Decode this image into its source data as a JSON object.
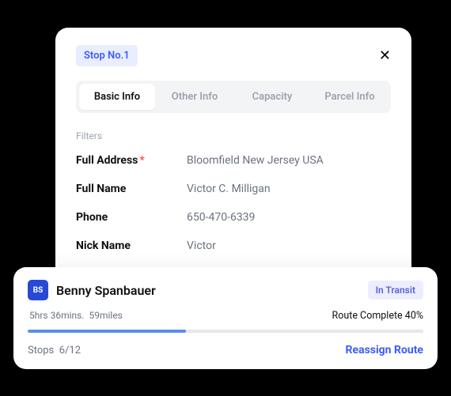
{
  "modal": {
    "stop_chip": "Stop No.1",
    "tabs": [
      {
        "label": "Basic Info",
        "active": true
      },
      {
        "label": "Other Info",
        "active": false
      },
      {
        "label": "Capacity",
        "active": false
      },
      {
        "label": "Parcel Info",
        "active": false
      }
    ],
    "filters_label": "Filters",
    "fields": {
      "full_address": {
        "label": "Full Address",
        "value": "Bloomfield New Jersey USA",
        "required": true
      },
      "full_name": {
        "label": "Full Name",
        "value": "Victor C. Milligan"
      },
      "phone": {
        "label": "Phone",
        "value": "650-470-6339"
      },
      "nick_name": {
        "label": "Nick Name",
        "value": "Victor"
      }
    }
  },
  "driver": {
    "initials": "BS",
    "name": "Benny Spanbauer",
    "status": "In Transit",
    "duration": "5hrs 36mins.",
    "distance": "59miles",
    "route_complete_label": "Route Complete 40%",
    "progress_percent": 40,
    "stops_label": "Stops",
    "stops_value": "6/12",
    "reassign_label": "Reassign Route"
  }
}
